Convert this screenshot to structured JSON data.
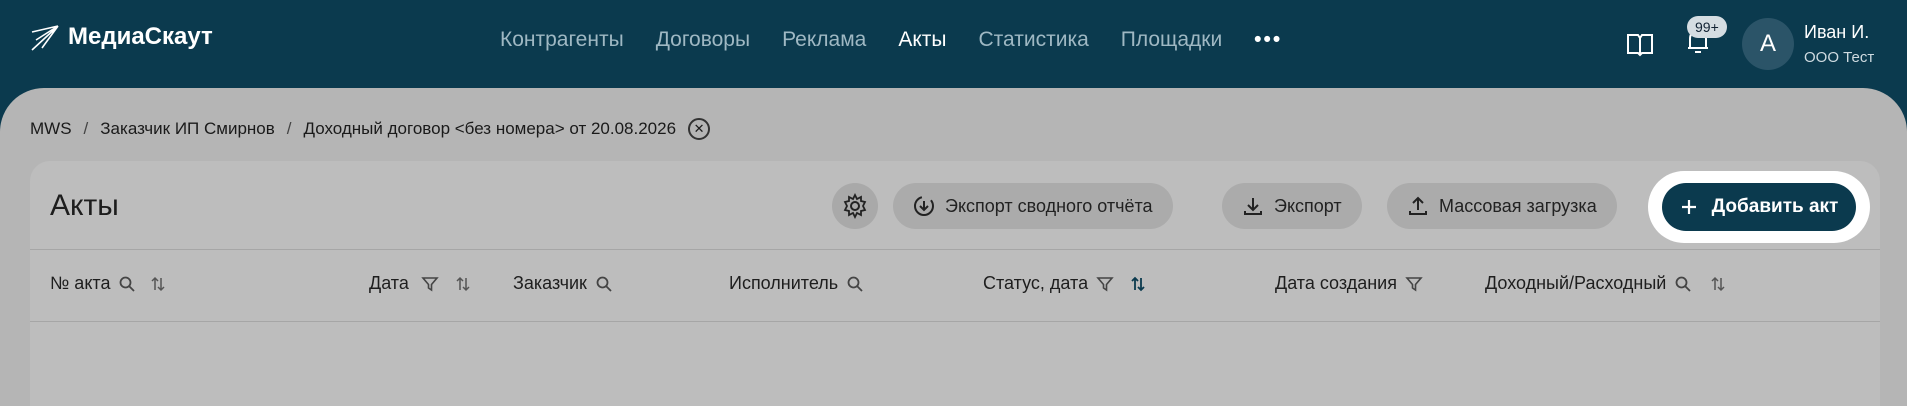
{
  "app": {
    "name": "МедиаСкаут"
  },
  "nav": {
    "items": [
      "Контрагенты",
      "Договоры",
      "Реклама",
      "Акты",
      "Статистика",
      "Площадки"
    ],
    "active": "Акты",
    "more_label": "•••"
  },
  "header": {
    "notifications_badge": "99+",
    "user_initial": "А",
    "user_name": "Иван И.",
    "user_org": "ООО Тест"
  },
  "breadcrumb": {
    "items": [
      "MWS",
      "Заказчик ИП Смирнов",
      "Доходный договор <без номера> от 20.08.2026"
    ],
    "separator": "/"
  },
  "page": {
    "title": "Акты",
    "actions": {
      "export_summary": "Экспорт сводного отчёта",
      "export": "Экспорт",
      "bulk_upload": "Массовая загрузка",
      "add": "Добавить акт"
    }
  },
  "table": {
    "columns": [
      "№ акта",
      "Дата",
      "Заказчик",
      "Исполнитель",
      "Статус, дата",
      "Дата создания",
      "Доходный/Расходный"
    ]
  },
  "colors": {
    "brand": "#0b3a4e",
    "overlay": "#b5b5b5",
    "highlight": "#ffffff"
  },
  "icons": [
    "logo-icon",
    "book-icon",
    "bell-icon",
    "close-circle-icon",
    "gear-icon",
    "export-summary-icon",
    "download-icon",
    "upload-icon",
    "plus-icon",
    "search-icon",
    "filter-icon",
    "sort-icon"
  ]
}
